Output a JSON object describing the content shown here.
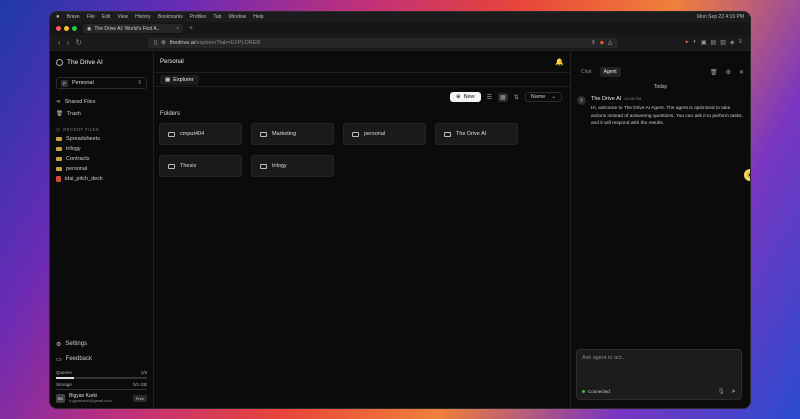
{
  "menubar": {
    "apple": "",
    "items": [
      "Brave",
      "File",
      "Edit",
      "View",
      "History",
      "Bookmarks",
      "Profiles",
      "Tab",
      "Window",
      "Help"
    ],
    "clock": "Mon Sep 22 4:16 PM"
  },
  "browser": {
    "tab_title": "The Drive AI: World's First A...",
    "url_prefix": "thedrive.ai",
    "url_path": "/explorer?tab=EXPLORER"
  },
  "sidebar": {
    "brand": "The Drive AI",
    "workspace": {
      "badge": "P",
      "name": "Personal"
    },
    "nav": [
      {
        "label": "Shared Files",
        "icon": "share-icon"
      },
      {
        "label": "Trash",
        "icon": "trash-icon"
      }
    ],
    "recent_title": "RECENT FILES",
    "recent": [
      {
        "label": "Spreadsheets",
        "type": "folder"
      },
      {
        "label": "trilogy",
        "type": "folder"
      },
      {
        "label": "Contracts",
        "type": "folder"
      },
      {
        "label": "personal",
        "type": "folder"
      },
      {
        "label": "tdai_pitch_deck",
        "type": "file"
      }
    ],
    "settings": "Settings",
    "feedback": "Feedback",
    "queries": {
      "label": "Queries",
      "value": "1/5",
      "fraction": 0.2
    },
    "storage": {
      "label": "Storage",
      "value": "0/1 GB",
      "fraction": 0.0
    },
    "user": {
      "initials": "BK",
      "name": "Bigyan Karki",
      "email": "b.gyankarki@gmail.com",
      "plan": "Free"
    }
  },
  "main": {
    "breadcrumb": "Personal",
    "tab": "Explorer",
    "new_label": "New",
    "sort_label": "Name",
    "folders_title": "Folders",
    "folders": [
      "cmput404",
      "Marketing",
      "personal",
      "The Drive AI",
      "Thesis",
      "trilogy"
    ]
  },
  "chat": {
    "tabs": [
      "Chat",
      "Agent"
    ],
    "today": "Today",
    "agent_name": "The Drive AI",
    "time": "04:16 PM",
    "message": "Hi, welcome to The Drive AI Agent. The agent is optimized to take actions instead of answering questions. You can ask it to perform tasks, and it will respond with the results.",
    "placeholder": "Ask agent to act...",
    "status": "Connected"
  },
  "colors": {
    "status_connected": "#3fb950",
    "folder": "#c9a24a",
    "pdf": "#d24a3a"
  }
}
